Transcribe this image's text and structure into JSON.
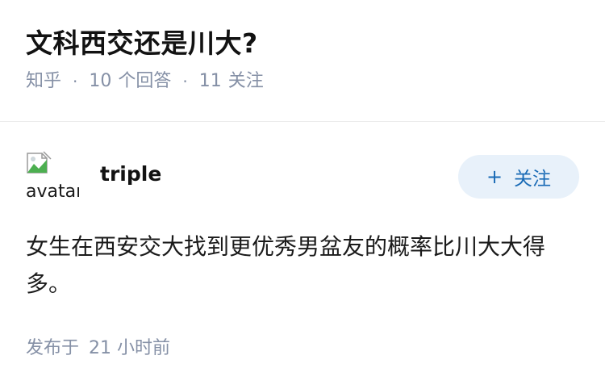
{
  "question": {
    "title": "文科西交还是川大?",
    "source": "知乎",
    "separator": "·",
    "answer_count": "10",
    "answer_label": "个回答",
    "follow_count": "11",
    "follow_label": "关注"
  },
  "author": {
    "avatar_alt": "avatar",
    "name": "triple",
    "follow_button_label": "关注",
    "follow_button_icon": "plus-icon"
  },
  "answer": {
    "content": "女生在西安交大找到更优秀男盆友的概率比川大大得多。",
    "published_label": "发布于",
    "published_time": "21 小时前"
  },
  "colors": {
    "meta_gray": "#8590a6",
    "follow_bg": "#e8f1fa",
    "follow_text": "#1a6bb6",
    "divider": "#ebebeb"
  }
}
